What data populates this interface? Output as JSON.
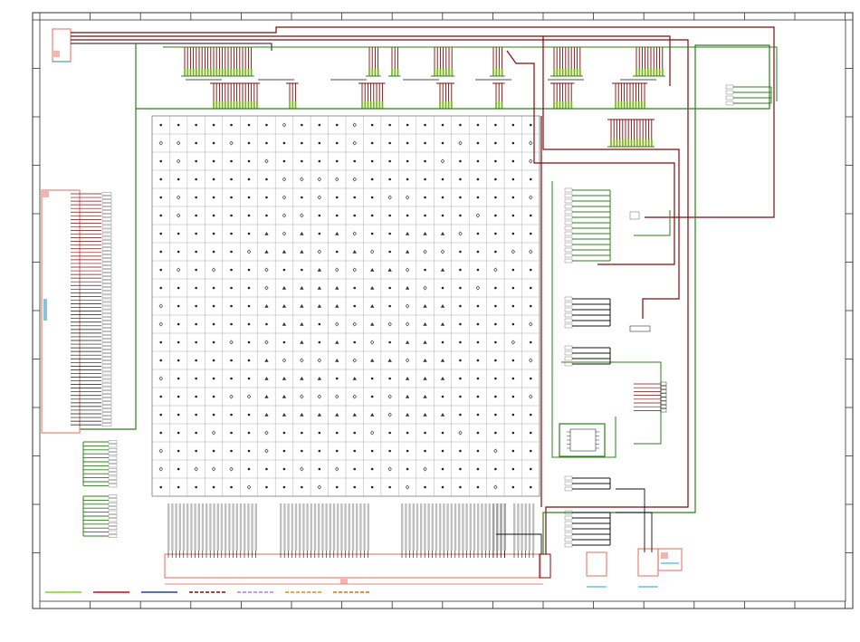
{
  "sheet": {
    "border_labels_top": [
      "",
      "",
      "",
      "",
      "",
      "",
      "",
      "",
      "",
      "",
      "",
      "",
      "",
      "",
      "",
      "",
      ""
    ],
    "grid_rows": 21,
    "grid_cols": 22
  },
  "legend": {
    "entries": [
      {
        "color": "#7ed321",
        "style": "solid"
      },
      {
        "color": "#d0021b",
        "style": "solid"
      },
      {
        "color": "#2141a8",
        "style": "solid"
      },
      {
        "color": "#7a0c0c",
        "style": "dashed"
      },
      {
        "color": "#b07ad8",
        "style": "dashed"
      },
      {
        "color": "#e08a1e",
        "style": "dashed"
      },
      {
        "color": "#d9661e",
        "style": "dashed"
      }
    ]
  },
  "colors": {
    "border": "#333333",
    "wire_green": "#2e7d1e",
    "wire_red": "#7a0c0c",
    "wire_black": "#111111",
    "connector": "#e8837a",
    "connector_fill": "#f2b6ae",
    "accent_blue": "#2aa0c8"
  },
  "labels": {
    "left_connector_text": "",
    "bottom_block_text": ""
  }
}
